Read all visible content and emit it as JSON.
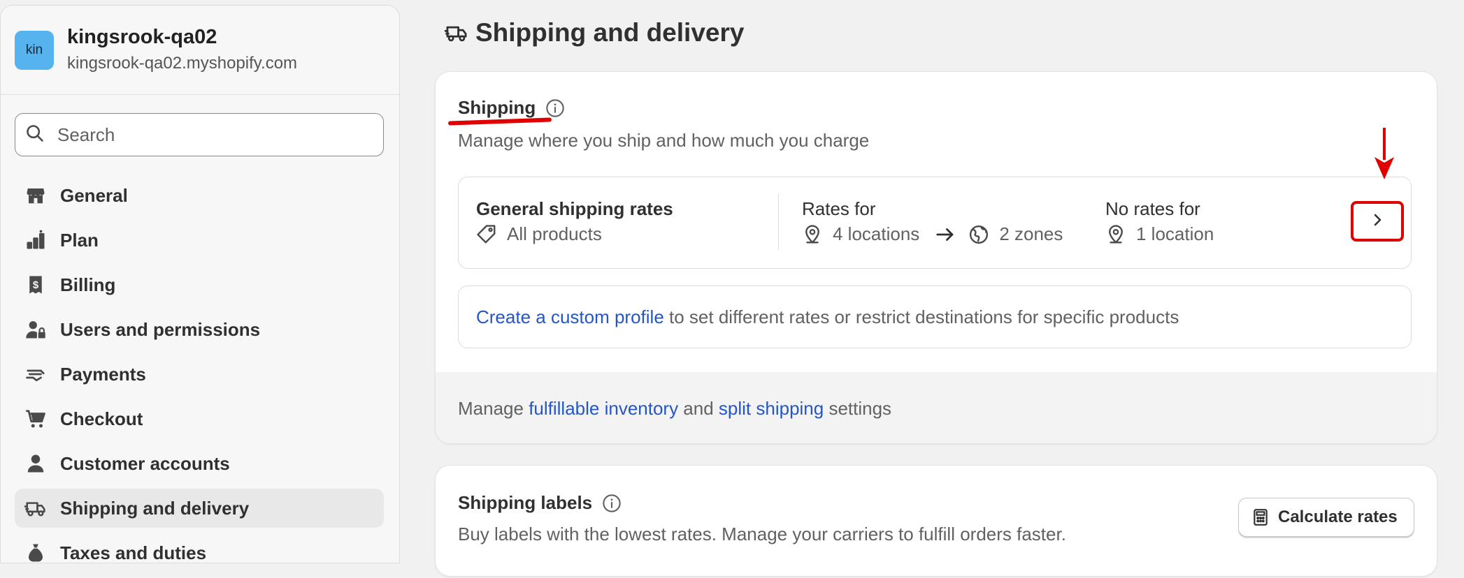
{
  "store": {
    "avatar_text": "kin",
    "name": "kingsrook-qa02",
    "domain": "kingsrook-qa02.myshopify.com"
  },
  "search": {
    "placeholder": "Search"
  },
  "sidebar": {
    "items": [
      {
        "label": "General",
        "icon": "store-icon"
      },
      {
        "label": "Plan",
        "icon": "plan-icon"
      },
      {
        "label": "Billing",
        "icon": "billing-icon"
      },
      {
        "label": "Users and permissions",
        "icon": "users-icon"
      },
      {
        "label": "Payments",
        "icon": "payments-icon"
      },
      {
        "label": "Checkout",
        "icon": "cart-icon"
      },
      {
        "label": "Customer accounts",
        "icon": "person-icon"
      },
      {
        "label": "Shipping and delivery",
        "icon": "truck-icon",
        "active": true
      },
      {
        "label": "Taxes and duties",
        "icon": "taxes-icon"
      }
    ]
  },
  "page": {
    "title": "Shipping and delivery"
  },
  "shipping": {
    "title": "Shipping",
    "subtitle": "Manage where you ship and how much you charge",
    "general_rates": {
      "title": "General shipping rates",
      "products": "All products",
      "rates_for_label": "Rates for",
      "locations": "4 locations",
      "zones": "2 zones",
      "no_rates_label": "No rates for",
      "no_rates_locations": "1 location"
    },
    "custom_profile": {
      "link": "Create a custom profile",
      "text": " to set different rates or restrict destinations for specific products"
    },
    "footer": {
      "prefix": "Manage ",
      "link1": "fulfillable inventory",
      "middle": " and ",
      "link2": "split shipping",
      "suffix": " settings"
    }
  },
  "labels": {
    "title": "Shipping labels",
    "subtitle": "Buy labels with the lowest rates. Manage your carriers to fulfill orders faster.",
    "calc_button": "Calculate rates"
  },
  "colors": {
    "accent_link": "#2456c8",
    "annotation_red": "#e00000",
    "avatar": "#57b3ee"
  }
}
